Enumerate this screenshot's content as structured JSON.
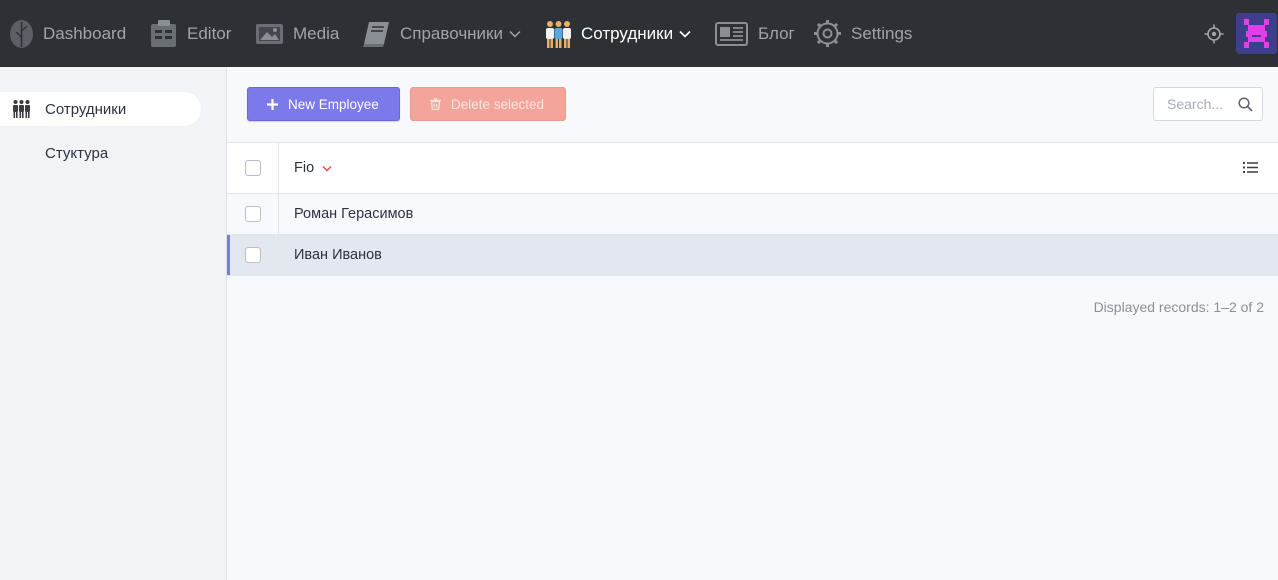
{
  "nav": {
    "items": [
      {
        "label": "Dashboard",
        "icon": "feather-logo-icon"
      },
      {
        "label": "Editor",
        "icon": "editor-icon"
      },
      {
        "label": "Media",
        "icon": "media-icon"
      },
      {
        "label": "Справочники",
        "icon": "book-icon"
      },
      {
        "label": "Сотрудники",
        "icon": "employees-icon"
      },
      {
        "label": "Блог",
        "icon": "blog-icon"
      },
      {
        "label": "Settings",
        "icon": "gear-icon"
      }
    ],
    "active": "Сотрудники"
  },
  "sidebar": {
    "items": [
      {
        "label": "Сотрудники",
        "icon": "employees-icon"
      },
      {
        "label": "Стуктура"
      }
    ]
  },
  "toolbar": {
    "new_label": "New Employee",
    "delete_label": "Delete selected",
    "search_placeholder": "Search..."
  },
  "table": {
    "column": "Fio",
    "rows": [
      "Роман Герасимов",
      "Иван Иванов"
    ]
  },
  "footer": {
    "records": "Displayed records: 1–2 of 2"
  },
  "colors": {
    "topbar": "#2d3035",
    "accent": "#7c79ea",
    "danger": "#f4a59b"
  }
}
